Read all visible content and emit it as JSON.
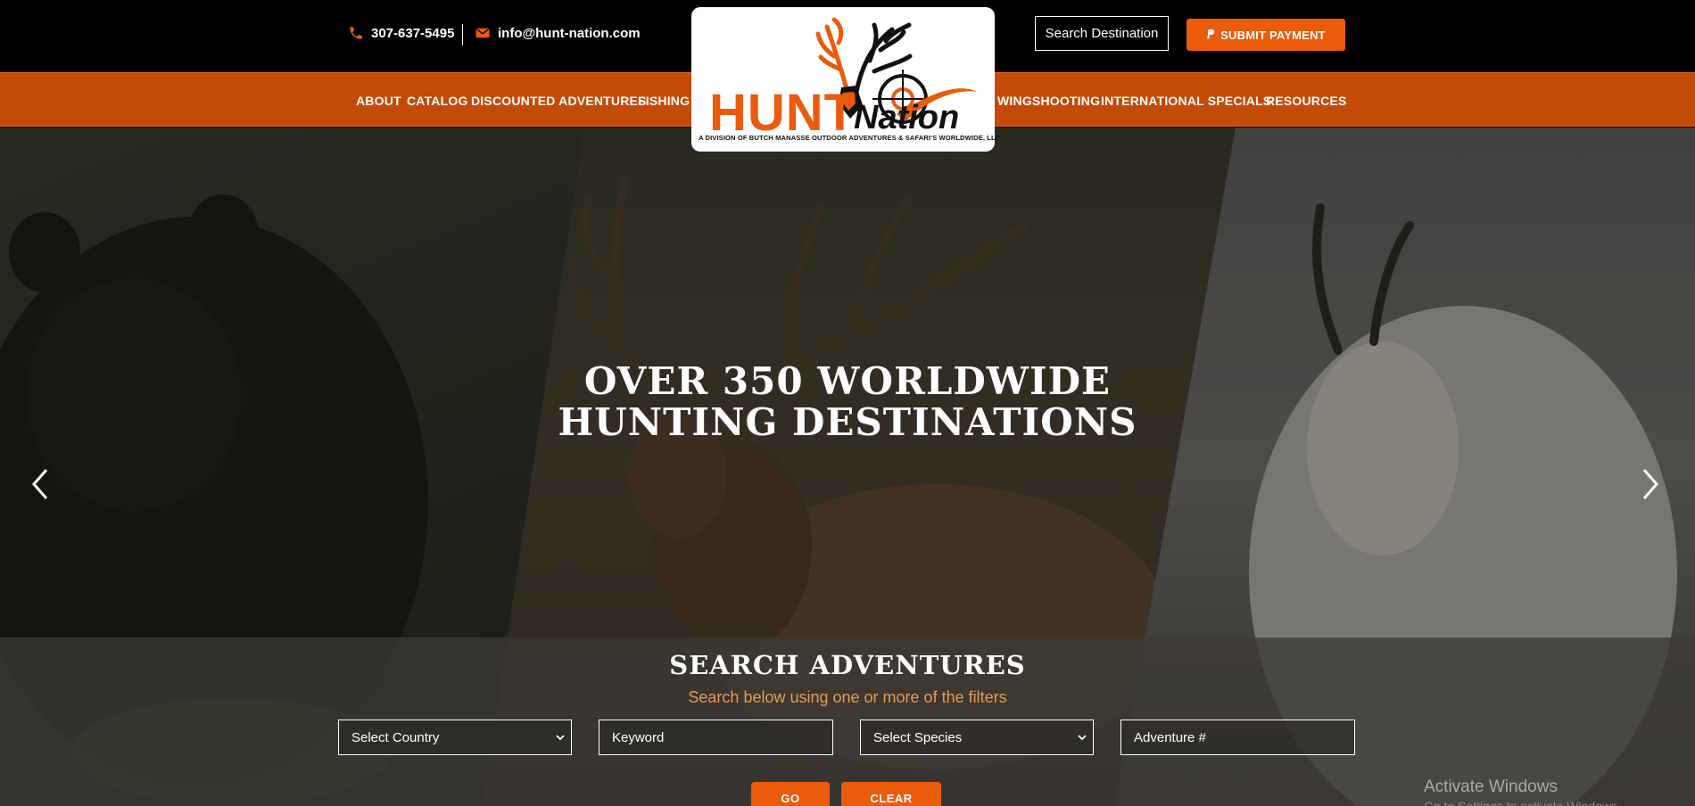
{
  "topbar": {
    "phone": "307-637-5495",
    "email": "info@hunt-nation.com",
    "search_destination": "Search Destination",
    "submit_payment": "SUBMIT PAYMENT"
  },
  "nav": {
    "items": [
      {
        "label": "ABOUT"
      },
      {
        "label": "CATALOG"
      },
      {
        "label": "DISCOUNTED ADVENTURES"
      },
      {
        "label": "FISHING"
      },
      {
        "label": "WINGSHOOTING"
      },
      {
        "label": "INTERNATIONAL SPECIALS"
      },
      {
        "label": "RESOURCES"
      }
    ]
  },
  "logo": {
    "word_hunt": "HUNT",
    "word_nation": "Nation",
    "tagline": "A DIVISION OF BUTCH MANASSE OUTDOOR ADVENTURES & SAFARI'S WORLDWIDE, LLC"
  },
  "hero": {
    "title_line1": "OVER 350 WORLDWIDE",
    "title_line2": "HUNTING DESTINATIONS"
  },
  "search": {
    "title": "SEARCH ADVENTURES",
    "subtitle": "Search below using one or more of the filters",
    "country_select": "Select Country",
    "keyword_placeholder": "Keyword",
    "species_select": "Select Species",
    "adventure_placeholder": "Adventure #",
    "go_label": "GO",
    "clear_label": "CLEAR"
  },
  "system": {
    "watermark": "Activate Windows",
    "watermark_sub": "Go to Settings to activate Windows."
  },
  "colors": {
    "brand_orange": "#ea5b0c",
    "nav_orange": "#c44a08",
    "accent_tan": "#e29b53"
  }
}
